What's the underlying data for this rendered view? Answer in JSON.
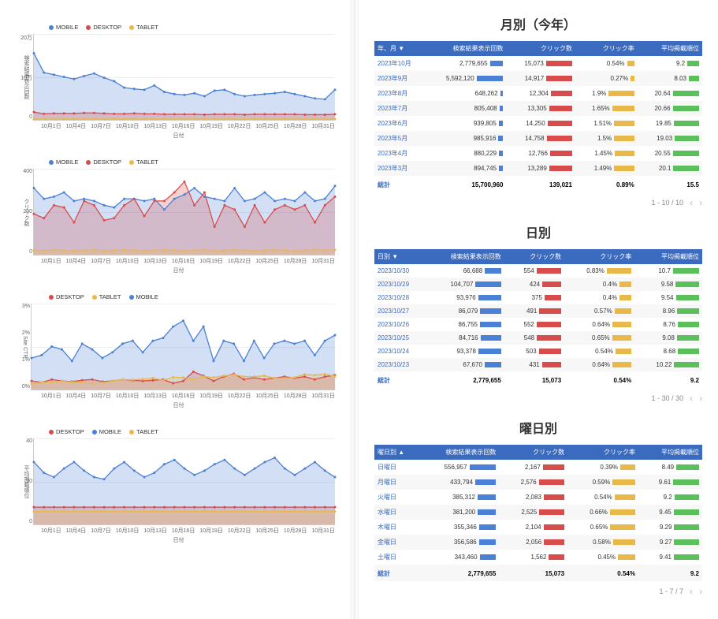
{
  "legends": {
    "mdt": [
      "MOBILE",
      "DESKTOP",
      "TABLET"
    ],
    "dtm": [
      "DESKTOP",
      "TABLET",
      "MOBILE"
    ],
    "dmt": [
      "DESKTOP",
      "MOBILE",
      "TABLET"
    ]
  },
  "colors": {
    "mobile": "#4a80d6",
    "desktop": "#d94c4c",
    "tablet": "#e8b84a",
    "green": "#5bbf5b"
  },
  "chart_data": [
    {
      "name": "impressions",
      "type": "area",
      "xlabel": "日付",
      "ylabel": "検索結果表示回数",
      "ylim": [
        0,
        200000
      ],
      "yticks": [
        "20万",
        "10万",
        "0"
      ],
      "x": [
        "10月1日",
        "10月4日",
        "10月7日",
        "10月10日",
        "10月13日",
        "10月16日",
        "10月19日",
        "10月22日",
        "10月25日",
        "10月28日",
        "10月31日"
      ],
      "series": [
        {
          "name": "MOBILE",
          "color": "#4a80d6",
          "values": [
            155000,
            110000,
            105000,
            100000,
            95000,
            102000,
            108000,
            98000,
            90000,
            75000,
            72000,
            70000,
            80000,
            65000,
            60000,
            58000,
            62000,
            55000,
            68000,
            70000,
            60000,
            55000,
            58000,
            60000,
            62000,
            65000,
            60000,
            55000,
            50000,
            48000,
            70000
          ]
        },
        {
          "name": "DESKTOP",
          "color": "#d94c4c",
          "values": [
            18000,
            14000,
            15000,
            15000,
            15000,
            16000,
            16000,
            15000,
            14000,
            14000,
            15000,
            14000,
            14000,
            13000,
            13000,
            13000,
            13000,
            12000,
            13000,
            13000,
            13000,
            12000,
            13000,
            13000,
            13000,
            13000,
            13000,
            12000,
            12000,
            12000,
            13000
          ]
        },
        {
          "name": "TABLET",
          "color": "#e8b84a",
          "values": [
            2000,
            2000,
            2000,
            2000,
            2000,
            2000,
            2000,
            2000,
            2000,
            2000,
            2000,
            2000,
            2000,
            2000,
            2000,
            2000,
            2000,
            2000,
            2000,
            2000,
            2000,
            2000,
            2000,
            2000,
            2000,
            2000,
            2000,
            2000,
            2000,
            2000,
            2000
          ]
        }
      ]
    },
    {
      "name": "clicks",
      "type": "area",
      "xlabel": "日付",
      "ylabel": "クリック数",
      "ylim": [
        0,
        400
      ],
      "yticks": [
        "400",
        "200",
        "0"
      ],
      "x": [
        "10月1日",
        "10月4日",
        "10月7日",
        "10月10日",
        "10月13日",
        "10月16日",
        "10月19日",
        "10月22日",
        "10月25日",
        "10月28日",
        "10月31日"
      ],
      "series": [
        {
          "name": "MOBILE",
          "color": "#4a80d6",
          "values": [
            310,
            260,
            270,
            290,
            250,
            260,
            250,
            230,
            220,
            260,
            260,
            250,
            260,
            210,
            260,
            280,
            310,
            270,
            260,
            250,
            310,
            250,
            260,
            290,
            250,
            260,
            250,
            290,
            250,
            260,
            320
          ]
        },
        {
          "name": "DESKTOP",
          "color": "#d94c4c",
          "values": [
            190,
            170,
            230,
            220,
            150,
            250,
            230,
            160,
            170,
            230,
            260,
            180,
            250,
            250,
            290,
            340,
            230,
            290,
            130,
            230,
            210,
            130,
            230,
            150,
            210,
            230,
            210,
            230,
            150,
            230,
            270
          ]
        },
        {
          "name": "TABLET",
          "color": "#e8b84a",
          "values": [
            20,
            18,
            22,
            20,
            18,
            20,
            22,
            18,
            20,
            22,
            20,
            18,
            20,
            22,
            20,
            18,
            20,
            22,
            18,
            20,
            22,
            20,
            18,
            20,
            22,
            20,
            18,
            20,
            22,
            20,
            22
          ]
        }
      ]
    },
    {
      "name": "ctr",
      "type": "area",
      "xlabel": "日付",
      "ylabel": "Site CTR",
      "ylim": [
        0,
        3
      ],
      "yticks": [
        "3%",
        "2%",
        "1%",
        "0%"
      ],
      "x": [
        "10月1日",
        "10月4日",
        "10月7日",
        "10月10日",
        "10月13日",
        "10月16日",
        "10月19日",
        "10月22日",
        "10月25日",
        "10月28日",
        "10月31日"
      ],
      "series": [
        {
          "name": "DESKTOP",
          "color": "#4a80d6",
          "values": [
            1.1,
            1.2,
            1.5,
            1.4,
            1.0,
            1.6,
            1.4,
            1.1,
            1.3,
            1.6,
            1.7,
            1.3,
            1.7,
            1.8,
            2.2,
            2.4,
            1.7,
            2.2,
            1.0,
            1.7,
            1.6,
            1.0,
            1.7,
            1.1,
            1.6,
            1.7,
            1.6,
            1.7,
            1.2,
            1.7,
            1.9
          ]
        },
        {
          "name": "TABLET",
          "color": "#d94c4c",
          "values": [
            0.3,
            0.25,
            0.35,
            0.3,
            0.28,
            0.32,
            0.35,
            0.28,
            0.3,
            0.35,
            0.32,
            0.3,
            0.32,
            0.35,
            0.22,
            0.3,
            0.62,
            0.48,
            0.3,
            0.45,
            0.55,
            0.35,
            0.42,
            0.35,
            0.4,
            0.45,
            0.4,
            0.45,
            0.35,
            0.45,
            0.5
          ]
        },
        {
          "name": "MOBILE",
          "color": "#e8b84a",
          "values": [
            0.2,
            0.25,
            0.26,
            0.29,
            0.26,
            0.26,
            0.23,
            0.24,
            0.29,
            0.35,
            0.34,
            0.36,
            0.4,
            0.32,
            0.43,
            0.42,
            0.36,
            0.45,
            0.42,
            0.48,
            0.52,
            0.45,
            0.45,
            0.48,
            0.4,
            0.4,
            0.42,
            0.53,
            0.5,
            0.54,
            0.46
          ]
        }
      ]
    },
    {
      "name": "position",
      "type": "area",
      "xlabel": "日付",
      "ylabel": "平均掲載順位",
      "ylim": [
        0,
        40
      ],
      "yticks": [
        "40",
        "20",
        "0"
      ],
      "x": [
        "10月1日",
        "10月4日",
        "10月7日",
        "10月10日",
        "10月13日",
        "10月16日",
        "10月19日",
        "10月22日",
        "10月25日",
        "10月28日",
        "10月31日"
      ],
      "series": [
        {
          "name": "DESKTOP",
          "color": "#4a80d6",
          "values": [
            29,
            24,
            22,
            26,
            29,
            25,
            22,
            21,
            26,
            29,
            25,
            22,
            24,
            28,
            30,
            26,
            23,
            25,
            28,
            30,
            26,
            23,
            26,
            29,
            31,
            26,
            23,
            26,
            29,
            25,
            22
          ]
        },
        {
          "name": "MOBILE",
          "color": "#d94c4c",
          "values": [
            8,
            8,
            8,
            8,
            8,
            8,
            8,
            8,
            8,
            8,
            8,
            8,
            8,
            8,
            8,
            8,
            8,
            8,
            8,
            8,
            8,
            8,
            8,
            8,
            8,
            8,
            8,
            8,
            8,
            8,
            8
          ]
        },
        {
          "name": "TABLET",
          "color": "#e8b84a",
          "values": [
            6,
            6,
            6,
            6,
            6,
            6,
            6,
            6,
            6,
            6,
            6,
            6,
            6,
            6,
            6,
            6,
            6,
            6,
            6,
            6,
            6,
            6,
            6,
            6,
            6,
            6,
            6,
            6,
            6,
            6,
            6
          ]
        }
      ]
    }
  ],
  "monthly": {
    "title": "月別（今年）",
    "headers": [
      "年、月 ▼",
      "検索結果表示回数",
      "クリック数",
      "クリック率",
      "平均掲載順位"
    ],
    "rows": [
      {
        "k": "2023年10月",
        "i": "2,779,655",
        "c": "15,073",
        "r": "0.54%",
        "p": "9.2"
      },
      {
        "k": "2023年9月",
        "i": "5,592,120",
        "c": "14,917",
        "r": "0.27%",
        "p": "8.03"
      },
      {
        "k": "2023年8月",
        "i": "648,262",
        "c": "12,304",
        "r": "1.9%",
        "p": "20.64"
      },
      {
        "k": "2023年7月",
        "i": "805,408",
        "c": "13,305",
        "r": "1.65%",
        "p": "20.66"
      },
      {
        "k": "2023年6月",
        "i": "939,805",
        "c": "14,250",
        "r": "1.51%",
        "p": "19.85"
      },
      {
        "k": "2023年5月",
        "i": "985,916",
        "c": "14,758",
        "r": "1.5%",
        "p": "19.03"
      },
      {
        "k": "2023年4月",
        "i": "880,229",
        "c": "12,766",
        "r": "1.45%",
        "p": "20.55"
      },
      {
        "k": "2023年3月",
        "i": "894,745",
        "c": "13,289",
        "r": "1.49%",
        "p": "20.1"
      }
    ],
    "totals": [
      "総計",
      "15,700,960",
      "139,021",
      "0.89%",
      "15.5"
    ],
    "pager": "1 - 10 / 10"
  },
  "daily": {
    "title": "日別",
    "headers": [
      "日別 ▼",
      "検索結果表示回数",
      "クリック数",
      "クリック率",
      "平均掲載順位"
    ],
    "rows": [
      {
        "k": "2023/10/30",
        "i": "66,688",
        "c": "554",
        "r": "0.83%",
        "p": "10.7"
      },
      {
        "k": "2023/10/29",
        "i": "104,707",
        "c": "424",
        "r": "0.4%",
        "p": "9.58"
      },
      {
        "k": "2023/10/28",
        "i": "93,976",
        "c": "375",
        "r": "0.4%",
        "p": "9.54"
      },
      {
        "k": "2023/10/27",
        "i": "86,079",
        "c": "491",
        "r": "0.57%",
        "p": "8.96"
      },
      {
        "k": "2023/10/26",
        "i": "86,755",
        "c": "552",
        "r": "0.64%",
        "p": "8.76"
      },
      {
        "k": "2023/10/25",
        "i": "84,716",
        "c": "548",
        "r": "0.65%",
        "p": "9.08"
      },
      {
        "k": "2023/10/24",
        "i": "93,378",
        "c": "503",
        "r": "0.54%",
        "p": "8.68"
      },
      {
        "k": "2023/10/23",
        "i": "67,670",
        "c": "431",
        "r": "0.64%",
        "p": "10.22"
      }
    ],
    "totals": [
      "総計",
      "2,779,655",
      "15,073",
      "0.54%",
      "9.2"
    ],
    "pager": "1 - 30 / 30"
  },
  "weekday": {
    "title": "曜日別",
    "headers": [
      "曜日別 ▲",
      "検索結果表示回数",
      "クリック数",
      "クリック率",
      "平均掲載順位"
    ],
    "rows": [
      {
        "k": "日曜日",
        "i": "556,957",
        "c": "2,167",
        "r": "0.39%",
        "p": "8.49"
      },
      {
        "k": "月曜日",
        "i": "433,794",
        "c": "2,576",
        "r": "0.59%",
        "p": "9.61"
      },
      {
        "k": "火曜日",
        "i": "385,312",
        "c": "2,083",
        "r": "0.54%",
        "p": "9.2"
      },
      {
        "k": "水曜日",
        "i": "381,200",
        "c": "2,525",
        "r": "0.66%",
        "p": "9.45"
      },
      {
        "k": "木曜日",
        "i": "355,346",
        "c": "2,104",
        "r": "0.65%",
        "p": "9.29"
      },
      {
        "k": "金曜日",
        "i": "356,586",
        "c": "2,056",
        "r": "0.58%",
        "p": "9.27"
      },
      {
        "k": "土曜日",
        "i": "343,460",
        "c": "1,562",
        "r": "0.45%",
        "p": "9.41"
      }
    ],
    "totals": [
      "総計",
      "2,779,655",
      "15,073",
      "0.54%",
      "9.2"
    ],
    "pager": "1 - 7 / 7"
  }
}
